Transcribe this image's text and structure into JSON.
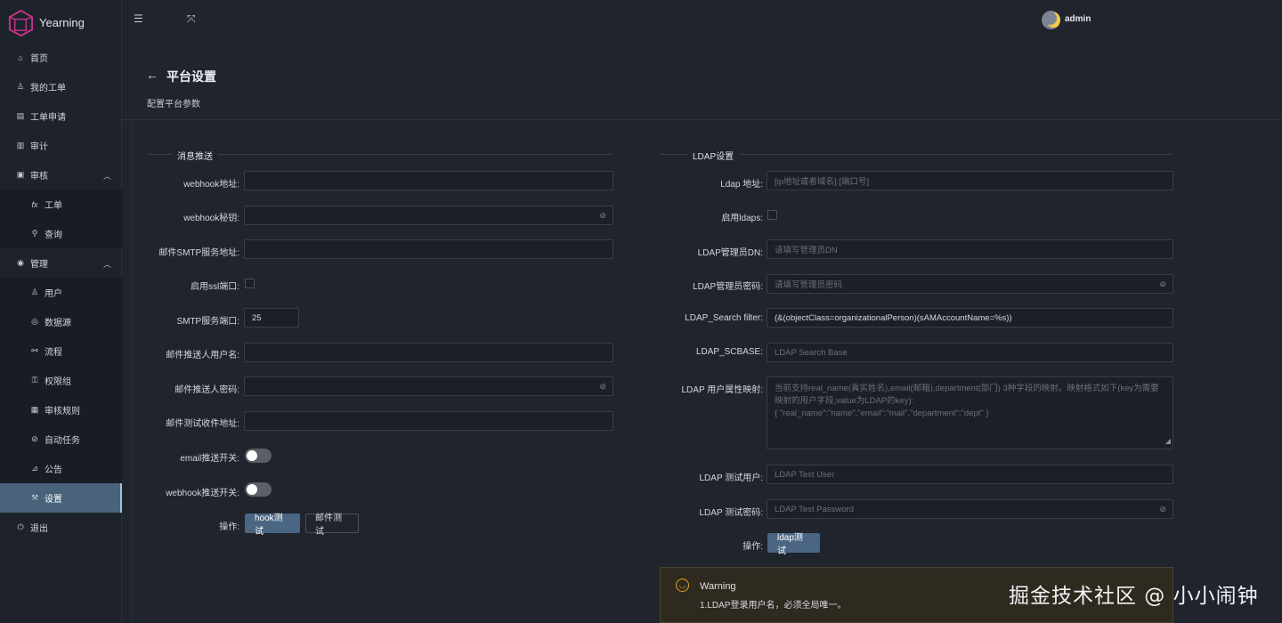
{
  "app": {
    "name": "Yearning"
  },
  "topbar": {
    "user": "admin"
  },
  "sidebar": {
    "items": [
      {
        "label": "首页",
        "icon": "home-icon"
      },
      {
        "label": "我的工单",
        "icon": "user-icon"
      },
      {
        "label": "工单申请",
        "icon": "form-icon"
      },
      {
        "label": "审计",
        "icon": "chart-icon"
      },
      {
        "label": "审核",
        "icon": "audit-icon"
      },
      {
        "label": "工单",
        "icon": "fx-icon"
      },
      {
        "label": "查询",
        "icon": "search-icon"
      },
      {
        "label": "管理",
        "icon": "eye-icon"
      },
      {
        "label": "用户",
        "icon": "user-icon"
      },
      {
        "label": "数据源",
        "icon": "database-icon"
      },
      {
        "label": "流程",
        "icon": "flow-icon"
      },
      {
        "label": "权限组",
        "icon": "key-icon"
      },
      {
        "label": "审核规则",
        "icon": "rule-icon"
      },
      {
        "label": "自动任务",
        "icon": "paperclip-icon"
      },
      {
        "label": "公告",
        "icon": "chart-line-icon"
      },
      {
        "label": "设置",
        "icon": "wrench-icon"
      },
      {
        "label": "退出",
        "icon": "logout-icon"
      }
    ]
  },
  "page": {
    "title": "平台设置",
    "subtitle": "配置平台参数"
  },
  "message": {
    "section_title": "消息推送",
    "webhook_url_label": "webhook地址:",
    "webhook_secret_label": "webhook秘钥:",
    "smtp_host_label": "邮件SMTP服务地址:",
    "ssl_label": "启用ssl端口:",
    "smtp_port_label": "SMTP服务端口:",
    "smtp_port_value": "25",
    "sender_user_label": "邮件推送人用户名:",
    "sender_pass_label": "邮件推送人密码:",
    "test_receiver_label": "邮件测试收件地址:",
    "email_switch_label": "email推送开关:",
    "webhook_switch_label": "webhook推送开关:",
    "ops_label": "操作:",
    "hook_test_button": "hook测试",
    "mail_test_button": "邮件测试"
  },
  "ldap": {
    "section_title": "LDAP设置",
    "url_label": "Ldap 地址:",
    "url_placeholder": "[ip地址或者域名]:[端口号]",
    "ldaps_label": "启用ldaps:",
    "admin_dn_label": "LDAP管理员DN:",
    "admin_dn_placeholder": "请填写管理员DN",
    "admin_pass_label": "LDAP管理员密码:",
    "admin_pass_placeholder": "请填写管理员密码",
    "filter_label": "LDAP_Search filter:",
    "filter_value": "(&(objectClass=organizationalPerson)(sAMAccountName=%s))",
    "scbase_label": "LDAP_SCBASE:",
    "scbase_placeholder": "LDAP Search Base",
    "mapping_label": "LDAP 用户属性映射:",
    "mapping_placeholder_line1": "当前支持real_name(真实姓名),email(邮箱),department(部门) 3种字段的映射。映射格式如下(key为需要",
    "mapping_placeholder_line2": "映射的用户字段,value为LDAP的key):",
    "mapping_placeholder_line3": "{ \"real_name\":\"name\",\"email\":\"mail\",\"department\":\"dept\" }",
    "test_user_label": "LDAP 测试用户:",
    "test_user_placeholder": "LDAP Test User",
    "test_pass_label": "LDAP 测试密码:",
    "test_pass_placeholder": "LDAP Test Password",
    "ops_label": "操作:",
    "ldap_test_button": "ldap测试"
  },
  "alert": {
    "title": "Warning",
    "description": "1.LDAP登录用户名，必须全局唯一。"
  },
  "watermark": "掘金技术社区 @ 小小闹钟"
}
